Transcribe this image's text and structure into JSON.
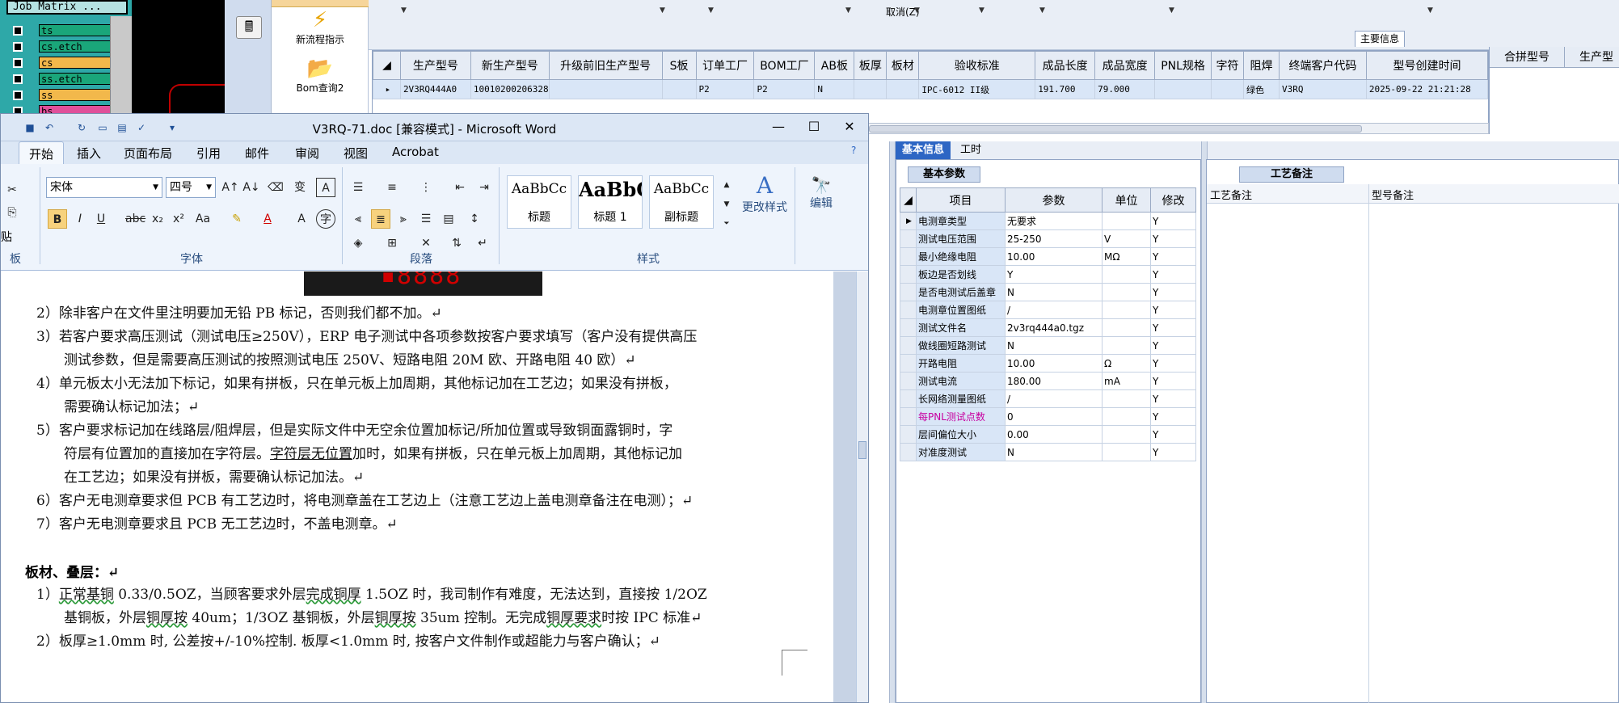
{
  "job_matrix": {
    "title": "Job Matrix ...",
    "layers": [
      {
        "name": "ts",
        "color": "#1aa67a"
      },
      {
        "name": "cs.etch",
        "color": "#1aa67a"
      },
      {
        "name": "cs",
        "color": "#f2b84b"
      },
      {
        "name": "ss.etch",
        "color": "#1aa67a"
      },
      {
        "name": "ss",
        "color": "#f2b84b"
      },
      {
        "name": "bs",
        "color": "#e0509a"
      }
    ]
  },
  "erp": {
    "tools": {
      "new_process": "新流程指示",
      "bom_query": "Bom查询2"
    },
    "menu": {
      "cancel": "取消(Z)"
    },
    "main_info_label": "主要信息",
    "grid": {
      "columns": [
        "生产型号",
        "新生产型号",
        "升级前旧生产型号",
        "S板",
        "订单工厂",
        "BOM工厂",
        "AB板",
        "板厚",
        "板材",
        "验收标准",
        "成品长度",
        "成品宽度",
        "PNL规格",
        "字符",
        "阻焊",
        "终端客户代码",
        "型号创建时间"
      ],
      "row": [
        "2V3RQ444A0",
        "10010200206328",
        "",
        "",
        "P2",
        "P2",
        "N",
        "",
        "",
        "IPC-6012 II级",
        "191.700",
        "79.000",
        "",
        "",
        "绿色",
        "V3RQ",
        "2025-09-22 21:21:28"
      ]
    },
    "right_grid_columns": [
      "合拼型号",
      "生产型"
    ],
    "lower_tabs": [
      "基本信息",
      "工时"
    ],
    "params": {
      "tab": "基本参数",
      "columns": [
        "项目",
        "参数",
        "单位",
        "修改"
      ],
      "rows": [
        {
          "item": "电测章类型",
          "param": "无要求",
          "unit": "",
          "mod": "Y"
        },
        {
          "item": "测试电压范围",
          "param": "25-250",
          "unit": "V",
          "mod": "Y"
        },
        {
          "item": "最小绝缘电阻",
          "param": "10.00",
          "unit": "MΩ",
          "mod": "Y"
        },
        {
          "item": "板边是否划线",
          "param": "Y",
          "unit": "",
          "mod": "Y"
        },
        {
          "item": "是否电测试后盖章",
          "param": "N",
          "unit": "",
          "mod": "Y"
        },
        {
          "item": "电测章位置图纸",
          "param": "/",
          "unit": "",
          "mod": "Y"
        },
        {
          "item": "测试文件名",
          "param": "2v3rq444a0.tgz",
          "unit": "",
          "mod": "Y"
        },
        {
          "item": "做线圈短路测试",
          "param": "N",
          "unit": "",
          "mod": "Y"
        },
        {
          "item": "开路电阻",
          "param": "10.00",
          "unit": "Ω",
          "mod": "Y"
        },
        {
          "item": "测试电流",
          "param": "180.00",
          "unit": "mA",
          "mod": "Y"
        },
        {
          "item": "长网络测量图纸",
          "param": "/",
          "unit": "",
          "mod": "Y"
        },
        {
          "item": "每PNL测试点数",
          "param": "0",
          "unit": "",
          "mod": "Y"
        },
        {
          "item": "层间偏位大小",
          "param": "0.00",
          "unit": "",
          "mod": "Y"
        },
        {
          "item": "对准度测试",
          "param": "N",
          "unit": "",
          "mod": "Y"
        }
      ]
    },
    "notes": {
      "tab": "工艺备注",
      "col1": "工艺备注",
      "col2": "型号备注"
    }
  },
  "word": {
    "title": "V3RQ-71.doc [兼容模式] - Microsoft Word",
    "tabs": [
      "开始",
      "插入",
      "页面布局",
      "引用",
      "邮件",
      "审阅",
      "视图",
      "Acrobat"
    ],
    "font_name": "宋体",
    "font_size": "四号",
    "groups": {
      "clipboard": "板",
      "font": "字体",
      "paragraph": "段落",
      "styles": "样式"
    },
    "clipboard_paste": "贴",
    "styles": [
      {
        "sample": "AaBbCc",
        "label": "标题"
      },
      {
        "sample": "AaBbC",
        "label": "标题 1"
      },
      {
        "sample": "AaBbCc",
        "label": "副标题"
      }
    ],
    "change_styles": "更改样式",
    "edit": "编辑",
    "doc": {
      "p2": "2）除非客户在文件里注明要加无铅 PB 标记，否则我们都不加。↵",
      "p3a": "3）若客户要求高压测试（测试电压≥250V），ERP 电子测试中各项参数按客户要求填写（客户没有提供高压",
      "p3b": "测试参数，但是需要高压测试的按照测试电压 250V、短路电阻 20M 欧、开路电阻 40 欧）↵",
      "p4a": "4）单元板太小无法加下标记，如果有拼板，只在单元板上加周期，其他标记加在工艺边；如果没有拼板，",
      "p4b": "需要确认标记加法；↵",
      "p5a": "5）客户要求标记加在线路层/阻焊层，但是实际文件中无空余位置加标记/所加位置或导致铜面露铜时，字",
      "p5b_pre": "符层有位置加的直接加在字符层。",
      "p5b_ul": "字符层无位置",
      "p5b_post": "加时，如果有拼板，只在单元板上加周期，其他标记加",
      "p5c": "在工艺边；如果没有拼板，需要确认标记加法。↵",
      "p6": "6）客户无电测章要求但 PCB 有工艺边时，将电测章盖在工艺边上（注意工艺边上盖电测章备注在电测）；↵",
      "p7": "7）客户无电测章要求且 PCB 无工艺边时，不盖电测章。↵",
      "heading": "板材、叠层：↵",
      "h1a_pre": "1）",
      "h1a_ul": "正常基铜",
      "h1a_mid": " 0.33/0.5OZ，当顾客要求外层",
      "h1a_ul2": "完成铜厚",
      "h1a_post": " 1.5OZ 时，我司制作有难度，无法达到，直接按 1/2OZ",
      "h1b_pre": "基铜板，外层",
      "h1b_ul": "铜厚按",
      "h1b_mid": " 40um；1/3OZ 基铜板，外层",
      "h1b_ul2": "铜厚按",
      "h1b_mid2": " 35um 控制。无完成",
      "h1b_ul3": "铜厚要求",
      "h1b_post": "时按 IPC 标准↵",
      "h2": "2）板厚≥1.0mm 时, 公差按+/-10%控制. 板厚<1.0mm 时, 按客户文件制作或超能力与客户确认；↵"
    }
  }
}
